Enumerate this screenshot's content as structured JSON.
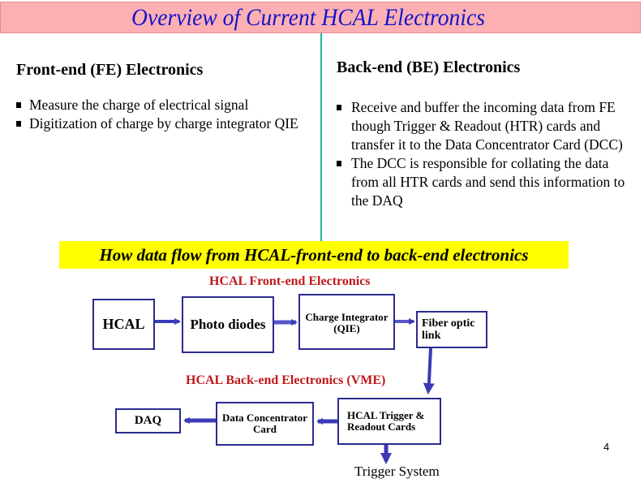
{
  "slide": {
    "title": "Overview of Current HCAL Electronics",
    "page_number": "4"
  },
  "front_end": {
    "heading": "Front-end (FE) Electronics",
    "bullets": [
      "Measure the charge of electrical signal",
      "Digitization of charge  by charge integrator QIE"
    ]
  },
  "back_end": {
    "heading": "Back-end (BE) Electronics",
    "bullets": [
      "Receive and buffer the incoming data from FE though Trigger & Readout (HTR) cards and transfer it to the Data Concentrator  Card (DCC)",
      "The DCC is responsible for collating the data from all HTR cards and send this information to the DAQ"
    ]
  },
  "flow": {
    "banner": "How data flow from HCAL-front-end to back-end electronics",
    "fe_section_label": "HCAL Front-end Electronics",
    "be_section_label": "HCAL Back-end Electronics (VME)",
    "boxes": {
      "hcal": "HCAL",
      "photo_diodes": "Photo diodes",
      "qie_line1": "Charge Integrator",
      "qie_line2": "(QIE)",
      "fiber_line1": "Fiber optic",
      "fiber_line2": "link",
      "daq": "DAQ",
      "dcc_line1": "Data Concentrator",
      "dcc_line2": "Card",
      "htr_line1": "HCAL Trigger &",
      "htr_line2": "Readout Cards"
    },
    "trigger_system": "Trigger System"
  },
  "colors": {
    "title_bg": "#fdb0b4",
    "title_text": "#1414c8",
    "divider": "#20b69a",
    "banner_bg": "#ffff00",
    "section_label": "#c01818",
    "box_border": "#2b2b8f",
    "arrow": "#3a3ab8"
  }
}
